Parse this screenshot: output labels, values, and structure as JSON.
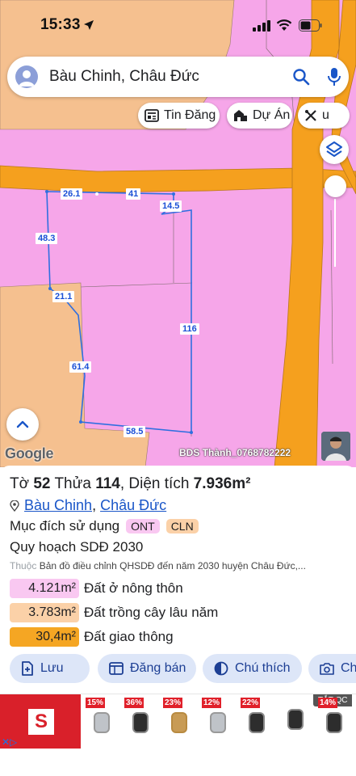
{
  "status_bar": {
    "time": "15:33"
  },
  "search": {
    "query": "Bàu Chinh, Châu Đức"
  },
  "chips": [
    {
      "label": "Tin Đăng",
      "icon": "newspaper-icon"
    },
    {
      "label": "Dự Án",
      "icon": "building-icon"
    },
    {
      "label": "u",
      "icon": "tools-icon"
    }
  ],
  "map": {
    "edge_lengths": [
      "26.1",
      "41",
      "14.5",
      "48.3",
      "21.1",
      "116",
      "61.4",
      "58.5"
    ],
    "attribution": "Google",
    "watermark": "BDS Thành_0768782222"
  },
  "plot": {
    "sheet_label": "Tờ",
    "sheet_no": "52",
    "parcel_label": "Thửa",
    "parcel_no": "114",
    "area_label": "Diện tích",
    "area": "7.936m²",
    "commune": "Bàu Chinh",
    "district": "Châu Đức",
    "purpose_label": "Mục đích sử dụng",
    "purpose_tags": [
      "ONT",
      "CLN"
    ],
    "plan_title": "Quy hoạch SDĐ 2030",
    "source_prefix": "Thuộc",
    "source_text": "Bản đồ điều chỉnh QHSDĐ đến năm 2030 huyện Châu Đức,..."
  },
  "land_use": [
    {
      "area": "4.121m²",
      "label": "Đất ở nông thôn",
      "color": "#f9c8f1"
    },
    {
      "area": "3.783m²",
      "label": "Đất trồng cây lâu năm",
      "color": "#fbd1a8"
    },
    {
      "area": "30,4m²",
      "label": "Đất giao thông",
      "color": "#f5a623"
    }
  ],
  "actions": [
    {
      "label": "Lưu",
      "icon": "save-plus-icon"
    },
    {
      "label": "Đăng bán",
      "icon": "listing-icon"
    },
    {
      "label": "Chú thích",
      "icon": "contrast-icon"
    },
    {
      "label": "Ch",
      "icon": "camera-plus-icon"
    }
  ],
  "ad": {
    "tag": "TẮT QC",
    "logo": "S",
    "badges": [
      "15%",
      "36%",
      "23%",
      "12%",
      "22%",
      "14%"
    ]
  },
  "colors": {
    "residential": "#f6a6e9",
    "perennial": "#f5c08f",
    "road": "#f5a01e",
    "boundary": "#2f6fe0",
    "accent": "#1a56c8"
  }
}
